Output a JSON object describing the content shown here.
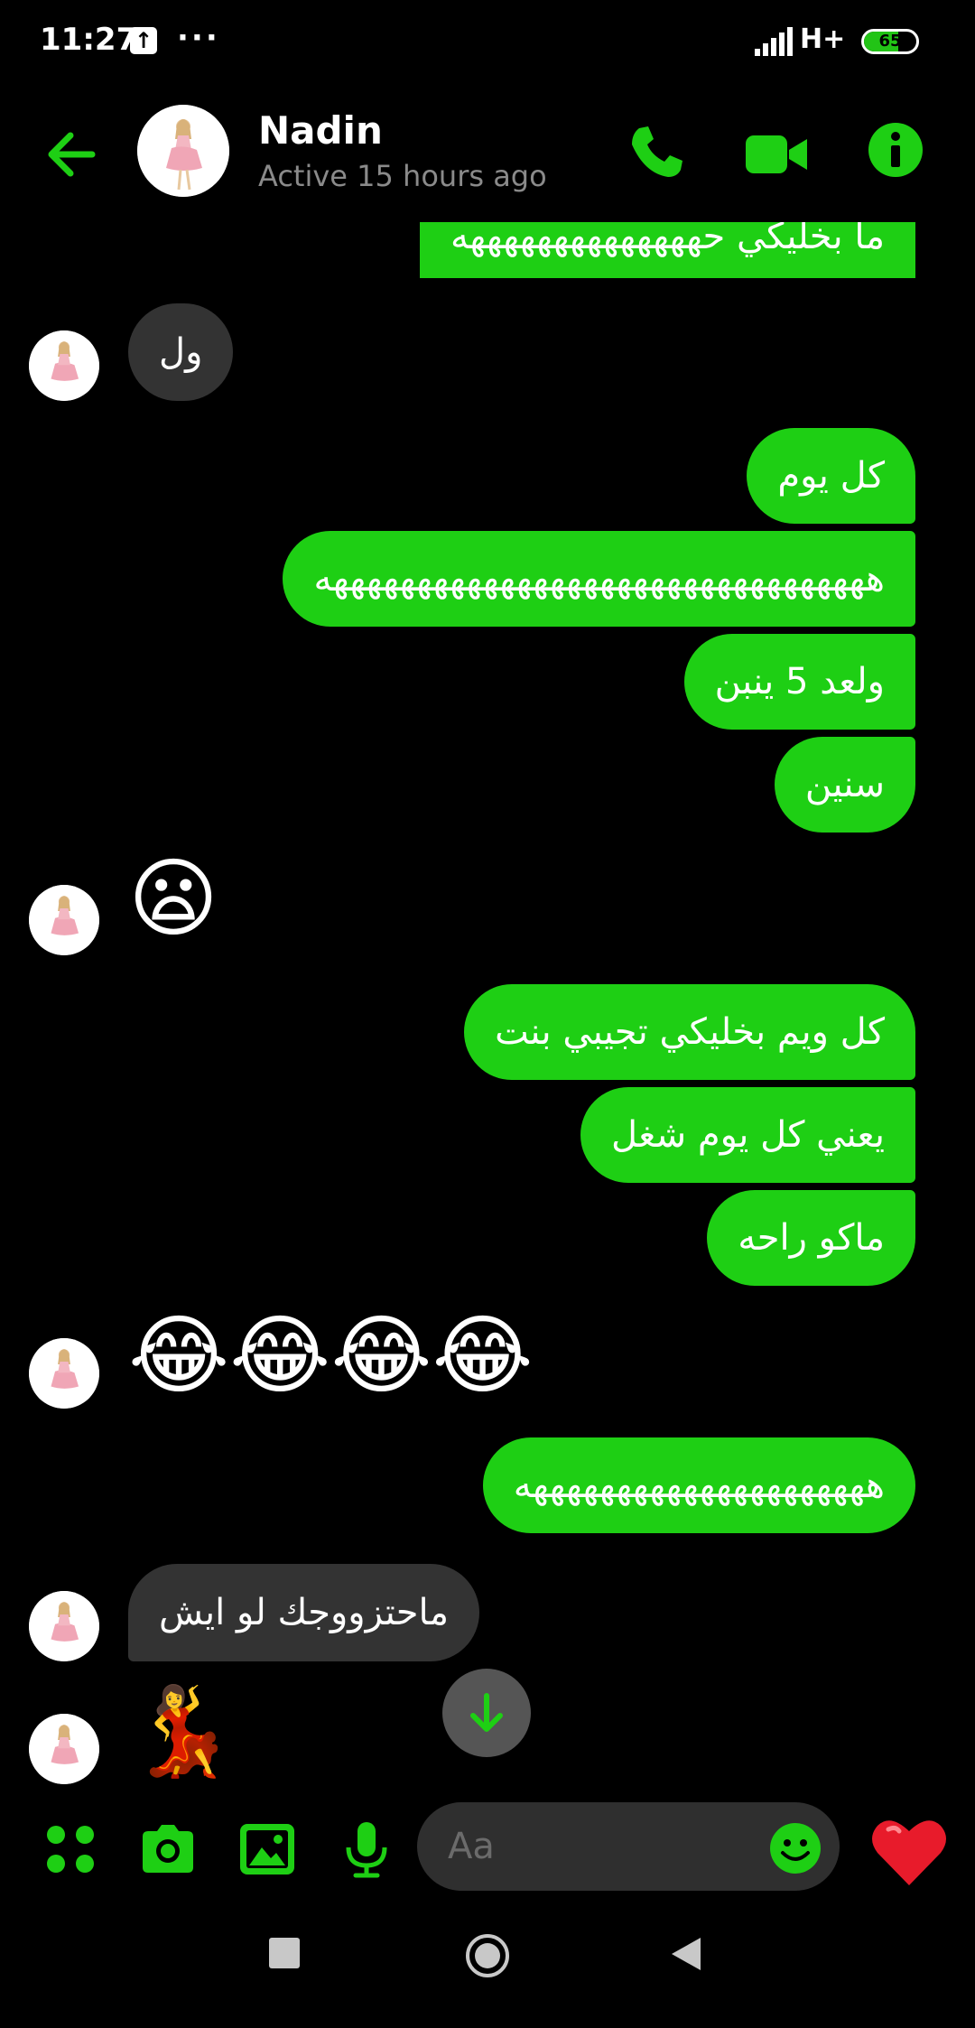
{
  "status_bar": {
    "time": "11:27",
    "upload_icon": "upload-arrow-icon",
    "more": "···",
    "network": "H+",
    "battery_level": "65"
  },
  "header": {
    "contact_name": "Nadin",
    "contact_status": "Active 15 hours ago",
    "icons": [
      "back-arrow-icon",
      "phone-icon",
      "video-camera-icon",
      "info-icon"
    ],
    "accent_color": "#1ecf14"
  },
  "messages": [
    {
      "side": "out",
      "text": "ما بخليكي حههههههههههههههه"
    },
    {
      "side": "in",
      "text": "ول"
    },
    {
      "side": "out",
      "text": "كل يوم"
    },
    {
      "side": "out",
      "text": "هههههههههههههههههههههههههههههههههه"
    },
    {
      "side": "out",
      "text": "ولعد 5 ينبن"
    },
    {
      "side": "out",
      "text": "سنين"
    },
    {
      "side": "in",
      "emoji": "😦"
    },
    {
      "side": "out",
      "text": "كل ويم بخليكي تجيبي بنت"
    },
    {
      "side": "out",
      "text": "يعني كل يوم شغل"
    },
    {
      "side": "out",
      "text": "ماكو راحه"
    },
    {
      "side": "in",
      "emoji": "😂😂😂😂"
    },
    {
      "side": "out",
      "text": "هههههههههههههههههههههه"
    },
    {
      "side": "in",
      "text": "ماحتزووجك لو ايش"
    },
    {
      "side": "in",
      "emoji": "💃"
    }
  ],
  "composer": {
    "placeholder": "Aa",
    "buttons": [
      "apps-icon",
      "camera-icon",
      "image-icon",
      "microphone-icon",
      "emoji-icon",
      "heart-icon"
    ]
  },
  "colors": {
    "outgoing_bubble": "#1ecf14",
    "incoming_bubble": "#333333",
    "background": "#000000"
  }
}
